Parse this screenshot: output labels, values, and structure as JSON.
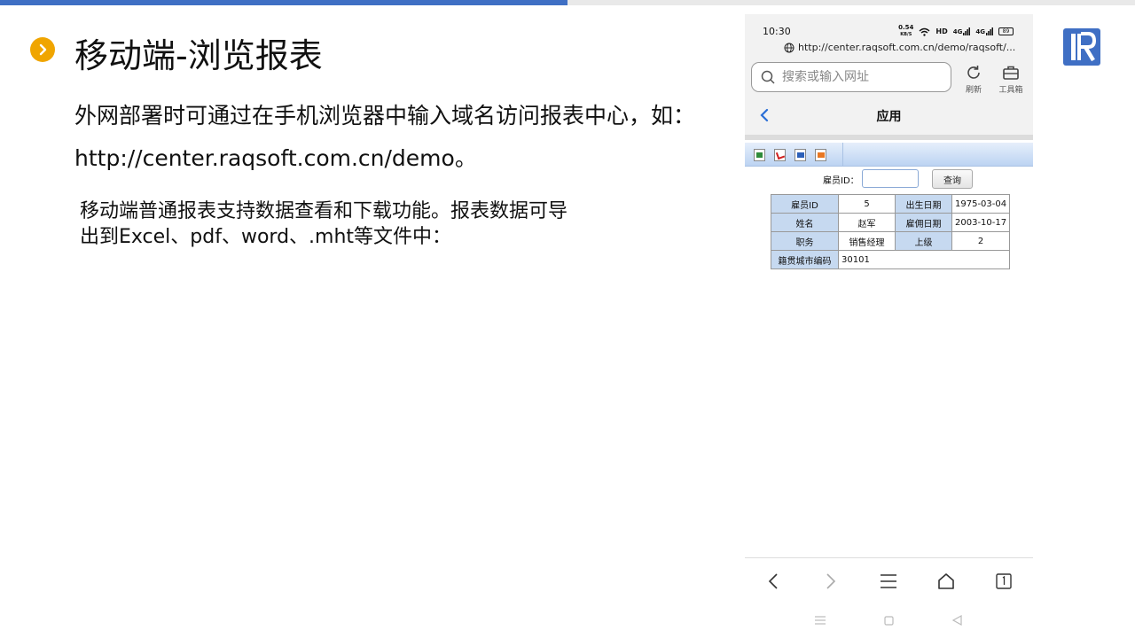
{
  "slide": {
    "title": "移动端-浏览报表",
    "para1": "外网部署时可通过在手机浏览器中输入域名访问报表中心，如：",
    "para2": "http://center.raqsoft.com.cn/demo。",
    "para3_line1": "移动端普通报表支持数据查看和下载功能。报表数据可导",
    "para3_line2": "出到Excel、pdf、word、.mht等文件中：",
    "accent_color": "#f0a500",
    "brand_color": "#3f6fc4",
    "logo_icon": "raqsoft-logo-icon"
  },
  "phone": {
    "status": {
      "time": "10:30",
      "speed": "0.54",
      "speed_unit": "KB/S",
      "hd": "HD",
      "signal1": "4G",
      "signal2": "4G",
      "battery": "89"
    },
    "browser": {
      "url": "http://center.raqsoft.com.cn/demo/raqsoft/...",
      "search_placeholder": "搜索或输入网址",
      "refresh_label": "刷新",
      "toolbox_label": "工具箱"
    },
    "app_title": "应用",
    "report": {
      "toolbar_icons": [
        "excel-export-icon",
        "pdf-export-icon",
        "word-export-icon",
        "mht-export-icon"
      ],
      "query_label": "雇员ID：",
      "query_value": "",
      "query_button": "查询",
      "rows": [
        {
          "h1": "雇员ID",
          "v1": "5",
          "h2": "出生日期",
          "v2": "1975-03-04"
        },
        {
          "h1": "姓名",
          "v1": "赵军",
          "h2": "雇佣日期",
          "v2": "2003-10-17"
        },
        {
          "h1": "职务",
          "v1": "销售经理",
          "h2": "上级",
          "v2": "2"
        }
      ],
      "last_row": {
        "h1": "籍贯城市编码",
        "v1": "30101"
      }
    }
  }
}
